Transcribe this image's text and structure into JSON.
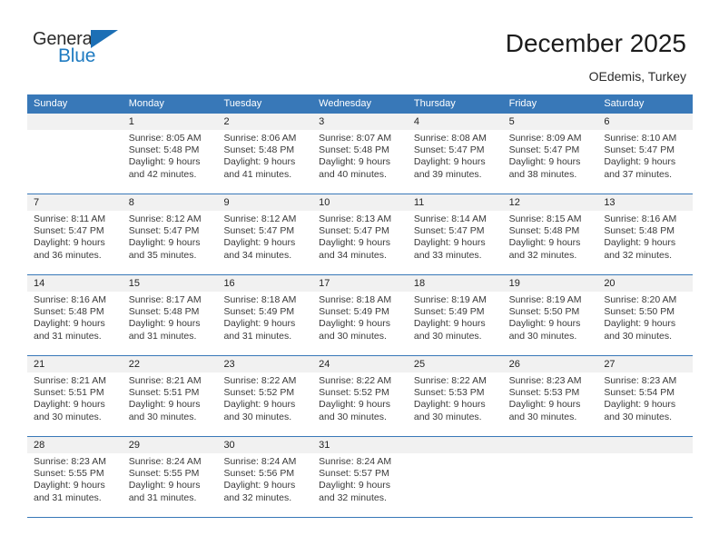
{
  "brand": {
    "name_part1": "General",
    "name_part2": "Blue",
    "flag_icon": "blue-triangle-flag-icon",
    "color_dark": "#2b2b2b",
    "color_blue": "#1f7bc1"
  },
  "header": {
    "title": "December 2025",
    "location": "OEdemis, Turkey"
  },
  "theme": {
    "header_blue": "#3878b8",
    "daynum_band": "#f1f1f1",
    "text": "#3a3a3a"
  },
  "weekday_headers": [
    "Sunday",
    "Monday",
    "Tuesday",
    "Wednesday",
    "Thursday",
    "Friday",
    "Saturday"
  ],
  "labels": {
    "sunrise_prefix": "Sunrise:",
    "sunset_prefix": "Sunset:",
    "daylight_prefix": "Daylight:"
  },
  "weeks": [
    [
      {
        "day": "",
        "lines": []
      },
      {
        "day": "1",
        "lines": [
          "Sunrise: 8:05 AM",
          "Sunset: 5:48 PM",
          "Daylight: 9 hours",
          "and 42 minutes."
        ]
      },
      {
        "day": "2",
        "lines": [
          "Sunrise: 8:06 AM",
          "Sunset: 5:48 PM",
          "Daylight: 9 hours",
          "and 41 minutes."
        ]
      },
      {
        "day": "3",
        "lines": [
          "Sunrise: 8:07 AM",
          "Sunset: 5:48 PM",
          "Daylight: 9 hours",
          "and 40 minutes."
        ]
      },
      {
        "day": "4",
        "lines": [
          "Sunrise: 8:08 AM",
          "Sunset: 5:47 PM",
          "Daylight: 9 hours",
          "and 39 minutes."
        ]
      },
      {
        "day": "5",
        "lines": [
          "Sunrise: 8:09 AM",
          "Sunset: 5:47 PM",
          "Daylight: 9 hours",
          "and 38 minutes."
        ]
      },
      {
        "day": "6",
        "lines": [
          "Sunrise: 8:10 AM",
          "Sunset: 5:47 PM",
          "Daylight: 9 hours",
          "and 37 minutes."
        ]
      }
    ],
    [
      {
        "day": "7",
        "lines": [
          "Sunrise: 8:11 AM",
          "Sunset: 5:47 PM",
          "Daylight: 9 hours",
          "and 36 minutes."
        ]
      },
      {
        "day": "8",
        "lines": [
          "Sunrise: 8:12 AM",
          "Sunset: 5:47 PM",
          "Daylight: 9 hours",
          "and 35 minutes."
        ]
      },
      {
        "day": "9",
        "lines": [
          "Sunrise: 8:12 AM",
          "Sunset: 5:47 PM",
          "Daylight: 9 hours",
          "and 34 minutes."
        ]
      },
      {
        "day": "10",
        "lines": [
          "Sunrise: 8:13 AM",
          "Sunset: 5:47 PM",
          "Daylight: 9 hours",
          "and 34 minutes."
        ]
      },
      {
        "day": "11",
        "lines": [
          "Sunrise: 8:14 AM",
          "Sunset: 5:47 PM",
          "Daylight: 9 hours",
          "and 33 minutes."
        ]
      },
      {
        "day": "12",
        "lines": [
          "Sunrise: 8:15 AM",
          "Sunset: 5:48 PM",
          "Daylight: 9 hours",
          "and 32 minutes."
        ]
      },
      {
        "day": "13",
        "lines": [
          "Sunrise: 8:16 AM",
          "Sunset: 5:48 PM",
          "Daylight: 9 hours",
          "and 32 minutes."
        ]
      }
    ],
    [
      {
        "day": "14",
        "lines": [
          "Sunrise: 8:16 AM",
          "Sunset: 5:48 PM",
          "Daylight: 9 hours",
          "and 31 minutes."
        ]
      },
      {
        "day": "15",
        "lines": [
          "Sunrise: 8:17 AM",
          "Sunset: 5:48 PM",
          "Daylight: 9 hours",
          "and 31 minutes."
        ]
      },
      {
        "day": "16",
        "lines": [
          "Sunrise: 8:18 AM",
          "Sunset: 5:49 PM",
          "Daylight: 9 hours",
          "and 31 minutes."
        ]
      },
      {
        "day": "17",
        "lines": [
          "Sunrise: 8:18 AM",
          "Sunset: 5:49 PM",
          "Daylight: 9 hours",
          "and 30 minutes."
        ]
      },
      {
        "day": "18",
        "lines": [
          "Sunrise: 8:19 AM",
          "Sunset: 5:49 PM",
          "Daylight: 9 hours",
          "and 30 minutes."
        ]
      },
      {
        "day": "19",
        "lines": [
          "Sunrise: 8:19 AM",
          "Sunset: 5:50 PM",
          "Daylight: 9 hours",
          "and 30 minutes."
        ]
      },
      {
        "day": "20",
        "lines": [
          "Sunrise: 8:20 AM",
          "Sunset: 5:50 PM",
          "Daylight: 9 hours",
          "and 30 minutes."
        ]
      }
    ],
    [
      {
        "day": "21",
        "lines": [
          "Sunrise: 8:21 AM",
          "Sunset: 5:51 PM",
          "Daylight: 9 hours",
          "and 30 minutes."
        ]
      },
      {
        "day": "22",
        "lines": [
          "Sunrise: 8:21 AM",
          "Sunset: 5:51 PM",
          "Daylight: 9 hours",
          "and 30 minutes."
        ]
      },
      {
        "day": "23",
        "lines": [
          "Sunrise: 8:22 AM",
          "Sunset: 5:52 PM",
          "Daylight: 9 hours",
          "and 30 minutes."
        ]
      },
      {
        "day": "24",
        "lines": [
          "Sunrise: 8:22 AM",
          "Sunset: 5:52 PM",
          "Daylight: 9 hours",
          "and 30 minutes."
        ]
      },
      {
        "day": "25",
        "lines": [
          "Sunrise: 8:22 AM",
          "Sunset: 5:53 PM",
          "Daylight: 9 hours",
          "and 30 minutes."
        ]
      },
      {
        "day": "26",
        "lines": [
          "Sunrise: 8:23 AM",
          "Sunset: 5:53 PM",
          "Daylight: 9 hours",
          "and 30 minutes."
        ]
      },
      {
        "day": "27",
        "lines": [
          "Sunrise: 8:23 AM",
          "Sunset: 5:54 PM",
          "Daylight: 9 hours",
          "and 30 minutes."
        ]
      }
    ],
    [
      {
        "day": "28",
        "lines": [
          "Sunrise: 8:23 AM",
          "Sunset: 5:55 PM",
          "Daylight: 9 hours",
          "and 31 minutes."
        ]
      },
      {
        "day": "29",
        "lines": [
          "Sunrise: 8:24 AM",
          "Sunset: 5:55 PM",
          "Daylight: 9 hours",
          "and 31 minutes."
        ]
      },
      {
        "day": "30",
        "lines": [
          "Sunrise: 8:24 AM",
          "Sunset: 5:56 PM",
          "Daylight: 9 hours",
          "and 32 minutes."
        ]
      },
      {
        "day": "31",
        "lines": [
          "Sunrise: 8:24 AM",
          "Sunset: 5:57 PM",
          "Daylight: 9 hours",
          "and 32 minutes."
        ]
      },
      {
        "day": "",
        "lines": []
      },
      {
        "day": "",
        "lines": []
      },
      {
        "day": "",
        "lines": []
      }
    ]
  ]
}
